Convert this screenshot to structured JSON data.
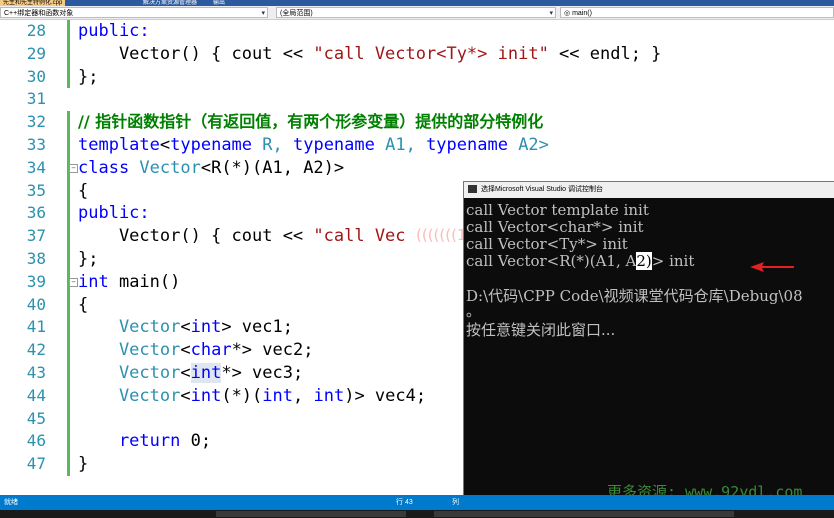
{
  "tabs": [
    "先生和先生特例化.cpp",
    "解决方案资源管理器",
    "输出"
  ],
  "navbar": {
    "scope": "C++绑定器和函数对象",
    "range": "(全局范围)",
    "member": "main()"
  },
  "lines": [
    "28",
    "29",
    "30",
    "31",
    "32",
    "33",
    "34",
    "35",
    "36",
    "37",
    "38",
    "39",
    "40",
    "41",
    "42",
    "43",
    "44",
    "45",
    "46",
    "47"
  ],
  "code": {
    "l28": "public:",
    "l29_a": "    Vector() { cout << ",
    "l29_s": "\"call Vector<Ty*> init\"",
    "l29_b": " << endl; }",
    "l30": "};",
    "l32": "// 指针函数指针（有返回值，有两个形参变量）提供的部分特例化",
    "l33_a": "template",
    "l33_b": "<",
    "l33_c": "typename",
    "l33_d": " R, ",
    "l33_e": "typename",
    "l33_f": " A1, ",
    "l33_g": "typename",
    "l33_h": " A2>",
    "l34_a": "class",
    "l34_b": " Vector",
    "l34_c": "<R(*)(A1, A2)>",
    "l35": "{",
    "l36": "public:",
    "l37_a": "    Vector() { cout << ",
    "l37_s": "\"call Vec",
    "l38": "};",
    "l39_a": "int",
    "l39_b": " main()",
    "l40": "{",
    "l41_a": "    Vector",
    "l41_b": "<",
    "l41_c": "int",
    "l41_d": "> vec1;",
    "l42_a": "    Vector",
    "l42_b": "<",
    "l42_c": "char",
    "l42_d": "*> vec2;",
    "l43_a": "    Vector",
    "l43_b": "<",
    "l43_c": "int",
    "l43_d": "*> vec3;",
    "l44_a": "    Vector",
    "l44_b": "<",
    "l44_c": "int",
    "l44_d": "(*)(",
    "l44_e": "int",
    "l44_f": ", ",
    "l44_g": "int",
    "l44_h": ")> vec4;",
    "l46_a": "    return",
    "l46_b": " 0;",
    "l47": "}"
  },
  "console": {
    "title": "选择Microsoft Visual Studio 调试控制台",
    "line1": "call Vector template init",
    "line2": "call Vector<char*> init",
    "line3": "call Vector<Ty*> init",
    "line4_a": "call Vector<R(*)(A1, A",
    "line4_cur": "2)",
    "line4_b": "> init",
    "line5": "D:\\代码\\CPP Code\\视频课堂代码仓库\\Debug\\08",
    "line6": "。",
    "line7": "按任意键关闭此窗口..."
  },
  "watermark": "更多资源: www.92ydl.com",
  "status": {
    "left": "就绪",
    "row": "行 43",
    "col": "列"
  }
}
